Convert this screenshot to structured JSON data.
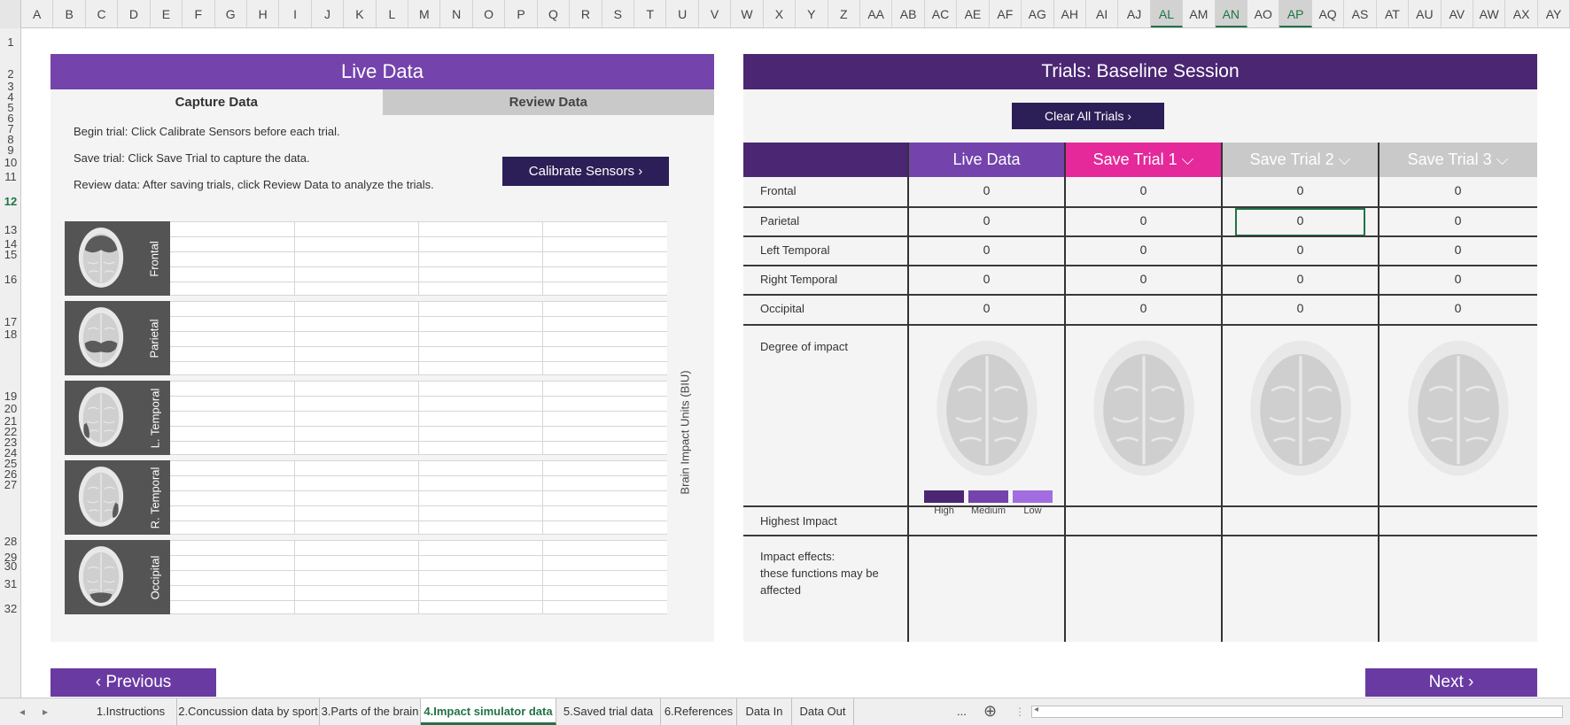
{
  "columns": [
    "A",
    "B",
    "C",
    "D",
    "E",
    "F",
    "G",
    "H",
    "I",
    "J",
    "K",
    "L",
    "M",
    "N",
    "O",
    "P",
    "Q",
    "R",
    "S",
    "T",
    "U",
    "V",
    "W",
    "X",
    "Y",
    "Z",
    "AA",
    "AB",
    "AC",
    "AE",
    "AF",
    "AG",
    "AH",
    "AI",
    "AJ",
    "AL",
    "AM",
    "AN",
    "AO",
    "AP",
    "AQ",
    "AS",
    "AT",
    "AU",
    "AV",
    "AW",
    "AX",
    "AY"
  ],
  "selected_columns": [
    "AL",
    "AN",
    "AP"
  ],
  "rows": [
    "1",
    "2",
    "3",
    "4",
    "5",
    "6",
    "7",
    "8",
    "9",
    "10",
    "11",
    "12",
    "13",
    "14",
    "15",
    "16",
    "17",
    "18",
    "19",
    "20",
    "21",
    "22",
    "23",
    "24",
    "25",
    "26",
    "27",
    "28",
    "29",
    "30",
    "31",
    "32"
  ],
  "selected_row": "12",
  "live_panel": {
    "title": "Live Data",
    "tab_capture": "Capture Data",
    "tab_review": "Review Data",
    "instructions": [
      "Begin trial: Click Calibrate Sensors before each trial.",
      "Save trial: Click Save Trial to capture the data.",
      "Review data: After saving trials, click Review Data to analyze the trials."
    ],
    "calibrate_button": "Calibrate Sensors ›",
    "sensors": [
      "Frontal",
      "Parietal",
      "L. Temporal",
      "R. Temporal",
      "Occipital"
    ],
    "axis_label": "Brain Impact Units (BIU)"
  },
  "trials_panel": {
    "title": "Trials: Baseline Session",
    "clear_button": "Clear All Trials ›",
    "columns": [
      "Live Data",
      "Save Trial 1 ⌵",
      "Save Trial 2 ⌵",
      "Save Trial 3 ⌵"
    ],
    "rows": [
      {
        "label": "Frontal",
        "values": [
          "0",
          "0",
          "0",
          "0"
        ]
      },
      {
        "label": "Parietal",
        "values": [
          "0",
          "0",
          "0",
          "0"
        ]
      },
      {
        "label": "Left Temporal",
        "values": [
          "0",
          "0",
          "0",
          "0"
        ]
      },
      {
        "label": "Right Temporal",
        "values": [
          "0",
          "0",
          "0",
          "0"
        ]
      },
      {
        "label": "Occipital",
        "values": [
          "0",
          "0",
          "0",
          "0"
        ]
      }
    ],
    "degree_label": "Degree of impact",
    "legend": [
      "High",
      "Medium",
      "Low"
    ],
    "highest_label": "Highest Impact",
    "effects_label": [
      "Impact effects:",
      "these functions may be",
      "affected"
    ]
  },
  "nav": {
    "previous": "‹ Previous",
    "next": "Next ›"
  },
  "sheet_tabs": [
    "1.Instructions",
    "2.Concussion data by sport",
    "3.Parts of the brain",
    "4.Impact simulator data",
    "5.Saved trial data",
    "6.References",
    "Data In",
    "Data Out"
  ],
  "active_sheet_tab": "4.Impact simulator data",
  "sheet_tabs_more": "...",
  "colors": {
    "purple_title": "#7443ac",
    "dark_purple": "#4a2673",
    "button_dark": "#2c1f57",
    "pink": "#e5299a",
    "grey_col": "#c9c9c9",
    "high": "#4a2673",
    "medium": "#7443ac",
    "low": "#a26de0"
  }
}
